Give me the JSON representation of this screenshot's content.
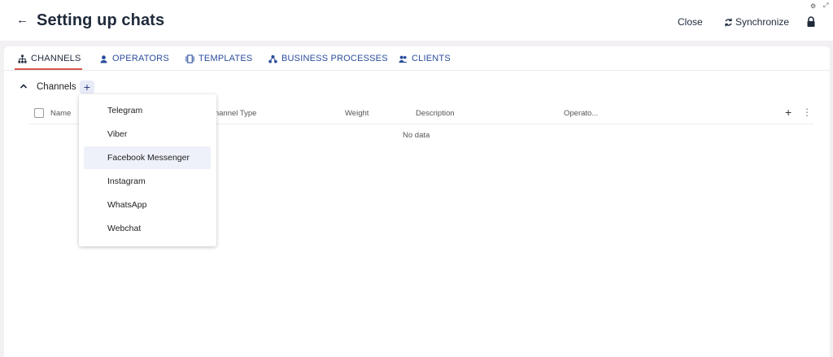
{
  "header": {
    "title": "Setting up chats",
    "close_label": "Close",
    "sync_label": "Synchronize"
  },
  "tabs": [
    {
      "label": "CHANNELS",
      "icon": "sitemap-icon",
      "active": true
    },
    {
      "label": "OPERATORS",
      "icon": "user-icon"
    },
    {
      "label": "TEMPLATES",
      "icon": "template-icon"
    },
    {
      "label": "BUSINESS PROCESSES",
      "icon": "process-icon"
    },
    {
      "label": "CLIENTS",
      "icon": "users-icon"
    }
  ],
  "section": {
    "label": "Channels",
    "add_label": "+"
  },
  "table": {
    "columns": [
      "Name",
      "Channel Type",
      "Weight",
      "Description",
      "Operato..."
    ],
    "empty_text": "No data",
    "add_label": "+",
    "more_label": "⋮"
  },
  "dropdown": {
    "items": [
      "Telegram",
      "Viber",
      "Facebook Messenger",
      "Instagram",
      "WhatsApp",
      "Webchat"
    ],
    "highlighted": "Facebook Messenger"
  },
  "colors": {
    "accent": "#2a4d9c",
    "active_underline": "#d9534f",
    "title": "#1f2a3a"
  }
}
